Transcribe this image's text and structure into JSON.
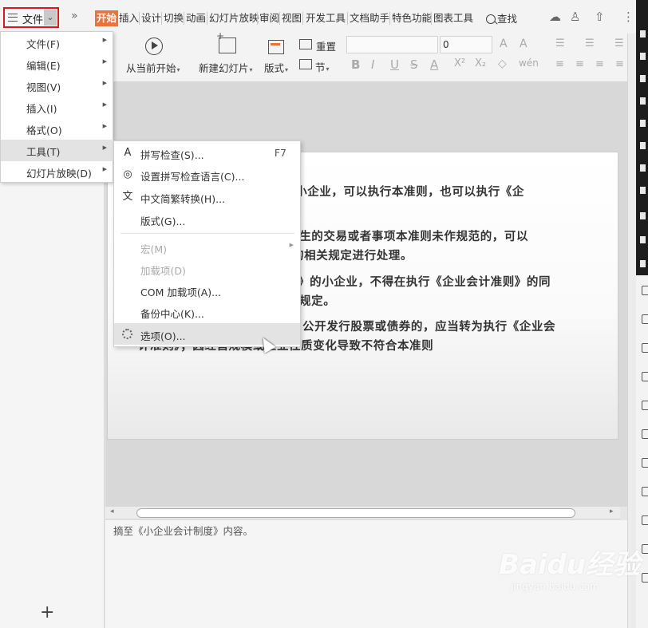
{
  "menubar": {
    "file_label": "文件",
    "more": "»",
    "tabs": [
      "开始",
      "插入",
      "设计",
      "切换",
      "动画",
      "幻灯片放映",
      "审阅",
      "视图",
      "开发工具",
      "文档助手",
      "特色功能",
      "图表工具"
    ],
    "search_label": "查找"
  },
  "ribbon": {
    "from_current": "从当前开始",
    "new_slide": "新建幻灯片",
    "layout": "版式",
    "reset": "重置",
    "section": "节",
    "font_name": "",
    "font_size": "0",
    "accent_color": "#e8743b"
  },
  "file_menu": {
    "items": [
      {
        "label": "文件(F)"
      },
      {
        "label": "编辑(E)"
      },
      {
        "label": "视图(V)"
      },
      {
        "label": "插入(I)"
      },
      {
        "label": "格式(O)"
      },
      {
        "label": "工具(T)"
      },
      {
        "label": "幻灯片放映(D)"
      }
    ]
  },
  "tools_menu": {
    "items": [
      {
        "label": "拼写检查(S)...",
        "shortcut": "F7"
      },
      {
        "label": "设置拼写检查语言(C)..."
      },
      {
        "label": "中文简繁转换(H)..."
      },
      {
        "label": "版式(G)..."
      },
      {
        "label": "宏(M)"
      },
      {
        "label": "加载项(D)"
      },
      {
        "label": "COM 加载项(A)..."
      },
      {
        "label": "备份中心(K)..."
      },
      {
        "label": "选项(O)..."
      }
    ]
  },
  "slide": {
    "lines": [
      "的小企业，可以执行本准则，也可以执行《企",
      "，发生的交易或者事项本准则未作规范的，可以",
      "的相关规定进行处理。",
      "》的小企业，不得在执行《企业会计准则》的同",
      "规定。",
      "公开发行股票或债券的，应当转为执行《企业会",
      "计准则》；因经营规模或企业性质变化导致不符合本准则"
    ]
  },
  "notes": {
    "text": "摘至《小企业会计制度》内容。"
  },
  "watermark": {
    "brand": "Baidu经验",
    "url": "jingyan.baidu.com"
  }
}
